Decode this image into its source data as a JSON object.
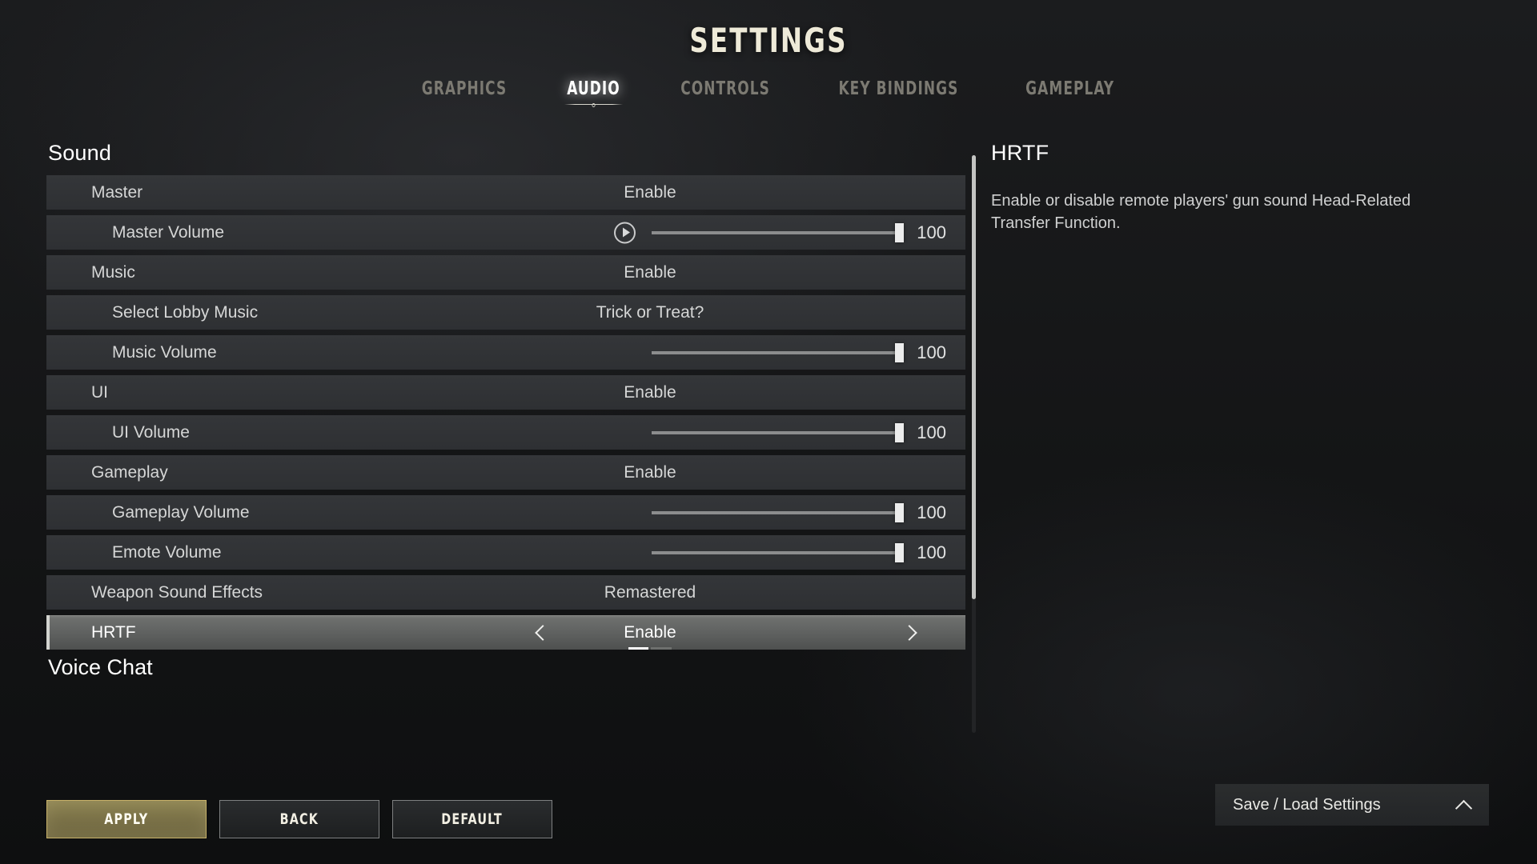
{
  "header": {
    "title": "SETTINGS",
    "tabs": [
      {
        "label": "GRAPHICS",
        "active": false
      },
      {
        "label": "AUDIO",
        "active": true
      },
      {
        "label": "CONTROLS",
        "active": false
      },
      {
        "label": "KEY BINDINGS",
        "active": false
      },
      {
        "label": "GAMEPLAY",
        "active": false
      }
    ]
  },
  "settings": {
    "section_title": "Sound",
    "next_section_title": "Voice Chat",
    "rows": [
      {
        "label": "Master",
        "value": "Enable",
        "type": "option",
        "indent": 1
      },
      {
        "label": "Master Volume",
        "value": "100",
        "type": "slider",
        "indent": 2,
        "slider_pct": 100,
        "has_preview": true
      },
      {
        "label": "Music",
        "value": "Enable",
        "type": "option",
        "indent": 1
      },
      {
        "label": "Select Lobby Music",
        "value": "Trick or Treat?",
        "type": "option",
        "indent": 2
      },
      {
        "label": "Music Volume",
        "value": "100",
        "type": "slider",
        "indent": 2,
        "slider_pct": 100,
        "has_preview": false
      },
      {
        "label": "UI",
        "value": "Enable",
        "type": "option",
        "indent": 1
      },
      {
        "label": "UI Volume",
        "value": "100",
        "type": "slider",
        "indent": 2,
        "slider_pct": 100,
        "has_preview": false
      },
      {
        "label": "Gameplay",
        "value": "Enable",
        "type": "option",
        "indent": 1
      },
      {
        "label": "Gameplay Volume",
        "value": "100",
        "type": "slider",
        "indent": 2,
        "slider_pct": 100,
        "has_preview": false
      },
      {
        "label": "Emote Volume",
        "value": "100",
        "type": "slider",
        "indent": 2,
        "slider_pct": 100,
        "has_preview": false
      },
      {
        "label": "Weapon Sound Effects",
        "value": "Remastered",
        "type": "option",
        "indent": 1
      },
      {
        "label": "HRTF",
        "value": "Enable",
        "type": "stepper",
        "indent": 1,
        "selected": true,
        "option_index": 0,
        "option_count": 2
      }
    ]
  },
  "info_panel": {
    "title": "HRTF",
    "description": "Enable or disable remote players' gun sound Head-Related Transfer Function."
  },
  "footer": {
    "buttons": [
      {
        "label": "APPLY",
        "primary": true
      },
      {
        "label": "BACK",
        "primary": false
      },
      {
        "label": "DEFAULT",
        "primary": false
      }
    ],
    "save_load": {
      "label": "Save / Load Settings",
      "icon": "chevron-up-icon"
    }
  },
  "colors": {
    "accent_gold": "#8d8352",
    "title_cream": "#eeead8",
    "row_bg": "#313336",
    "selected_row": "#5e605f",
    "page_bg": "#17181a"
  }
}
